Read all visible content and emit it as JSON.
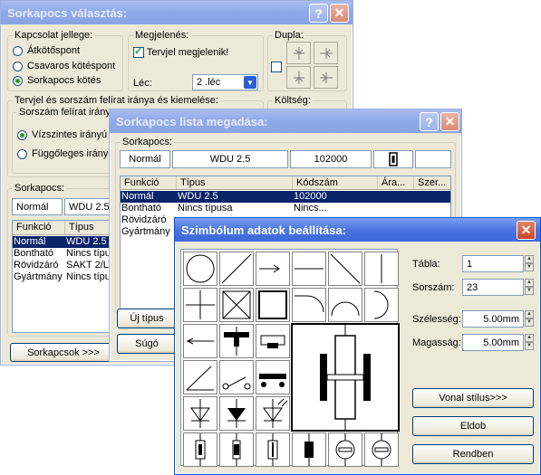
{
  "win1": {
    "title": "Sorkapocs választás:",
    "help": "?",
    "close": "✕",
    "conn_group": "Kapcsolat jellege:",
    "conn_options": [
      "Átkötőspont",
      "Csavaros kötéspont",
      "Sorkapocs kötés"
    ],
    "appear_group": "Megjelenés:",
    "symbol_visible": "Tervjel megjelenik!",
    "rail_label": "Léc:",
    "rail_value": "2 .léc",
    "double_group": "Dupla:",
    "cost_group": "Költség:",
    "direction_group": "Tervjel és sorszám felírat iránya és kiemelése:",
    "serial_group": "Sorszám felírat iránya:",
    "serial_options": [
      "Vízszintes irányú",
      "Függőleges irányú"
    ],
    "terminal_group": "Sorkapocs:",
    "terminal_mode": "Normál",
    "terminal_type": "WDU 2.5",
    "headers": [
      "Funkció",
      "Típus"
    ],
    "rows": [
      [
        "Normál",
        "WDU 2.5"
      ],
      [
        "Bontható",
        "Nincs típus"
      ],
      [
        "Rövidzáró",
        "SAKT 2/LT"
      ],
      [
        "Gyártmány",
        "Nincs típus"
      ]
    ],
    "terminals_button": "Sorkapcsok >>>"
  },
  "win2": {
    "title": "Sorkapocs lista megadása:",
    "help": "?",
    "close": "✕",
    "group": "Sorkapocs:",
    "mode": "Normál",
    "type": "WDU 2.5",
    "code": "102000",
    "headers": [
      "Funkció",
      "Típus",
      "Kódszám",
      "Ára...",
      "Szer..."
    ],
    "rows": [
      [
        "Normál",
        "WDU 2.5",
        "102000"
      ],
      [
        "Bontható",
        "Nincs típusa",
        "Nincs..."
      ],
      [
        "Rövidzáró",
        "",
        ""
      ],
      [
        "Gyártmány",
        "",
        ""
      ]
    ],
    "new_type": "Új típus",
    "help_button": "Súgó"
  },
  "win3": {
    "title": "Szimbólum adatok beállítása:",
    "close": "✕",
    "table_label": "Tábla:",
    "table_value": "1",
    "serial_label": "Sorszám:",
    "serial_value": "23",
    "width_label": "Szélesség:",
    "width_value": "5.00mm",
    "height_label": "Magasság:",
    "height_value": "5.00mm",
    "line_style": "Vonal stílus>>>",
    "drop": "Eldob",
    "ok": "Rendben"
  }
}
